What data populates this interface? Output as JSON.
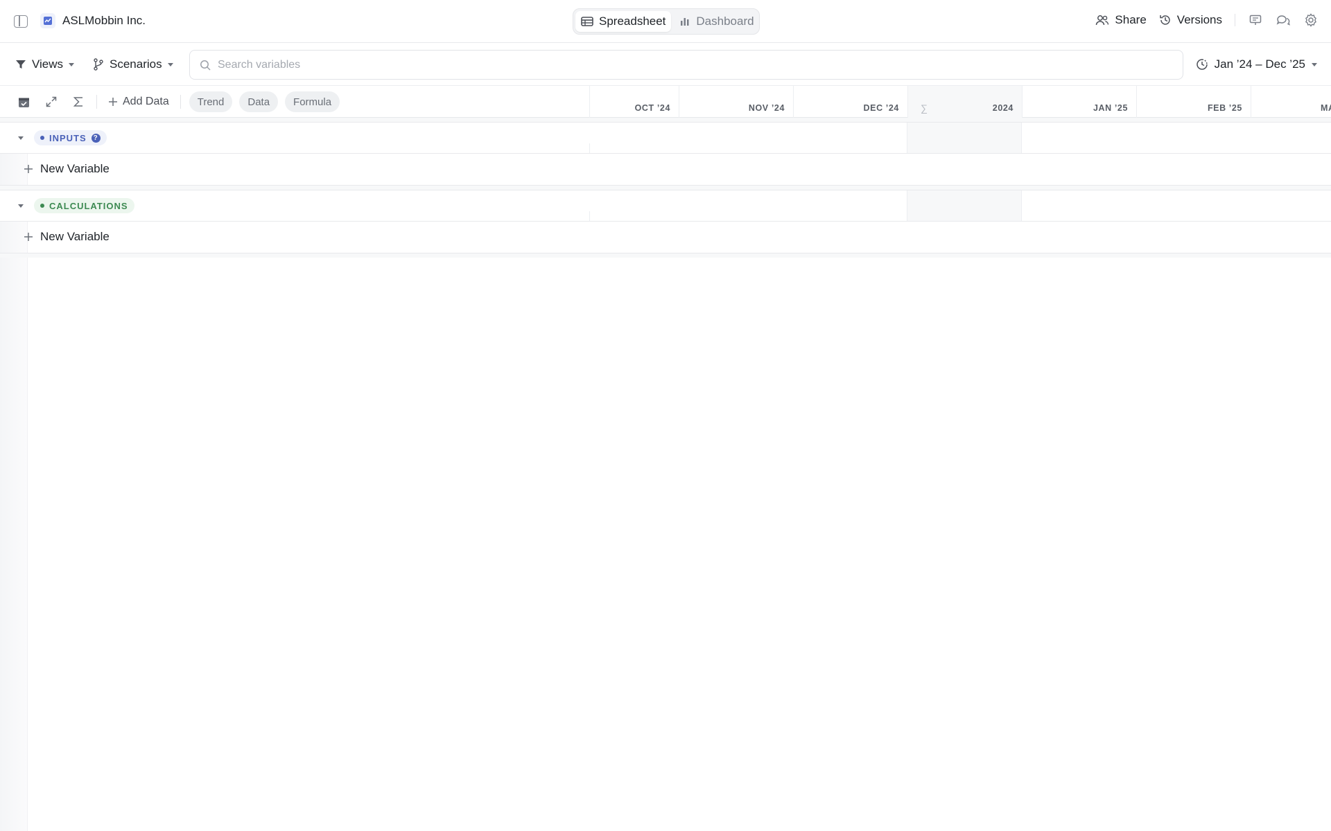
{
  "org": {
    "name": "ASLMobbin Inc."
  },
  "view_switch": [
    {
      "label": "Spreadsheet",
      "active": true,
      "icon": "table-icon"
    },
    {
      "label": "Dashboard",
      "active": false,
      "icon": "bar-chart-icon"
    }
  ],
  "top_actions": {
    "share": "Share",
    "versions": "Versions"
  },
  "filterbar": {
    "views": "Views",
    "scenarios": "Scenarios",
    "search_placeholder": "Search variables",
    "date_range": "Jan ’24 – Dec ’25"
  },
  "toolbar": {
    "add_data": "Add Data",
    "chips": [
      "Trend",
      "Data",
      "Formula"
    ]
  },
  "columns": [
    "OCT ’24",
    "NOV ’24",
    "DEC ’24",
    "2024",
    "JAN ’25",
    "FEB ’25",
    "MA"
  ],
  "sections": [
    {
      "label": "INPUTS",
      "new_variable": "New Variable"
    },
    {
      "label": "CALCULATIONS",
      "new_variable": "New Variable"
    }
  ],
  "colors": {
    "inputs": "#4a61b8",
    "calculations": "#3d8a52"
  }
}
